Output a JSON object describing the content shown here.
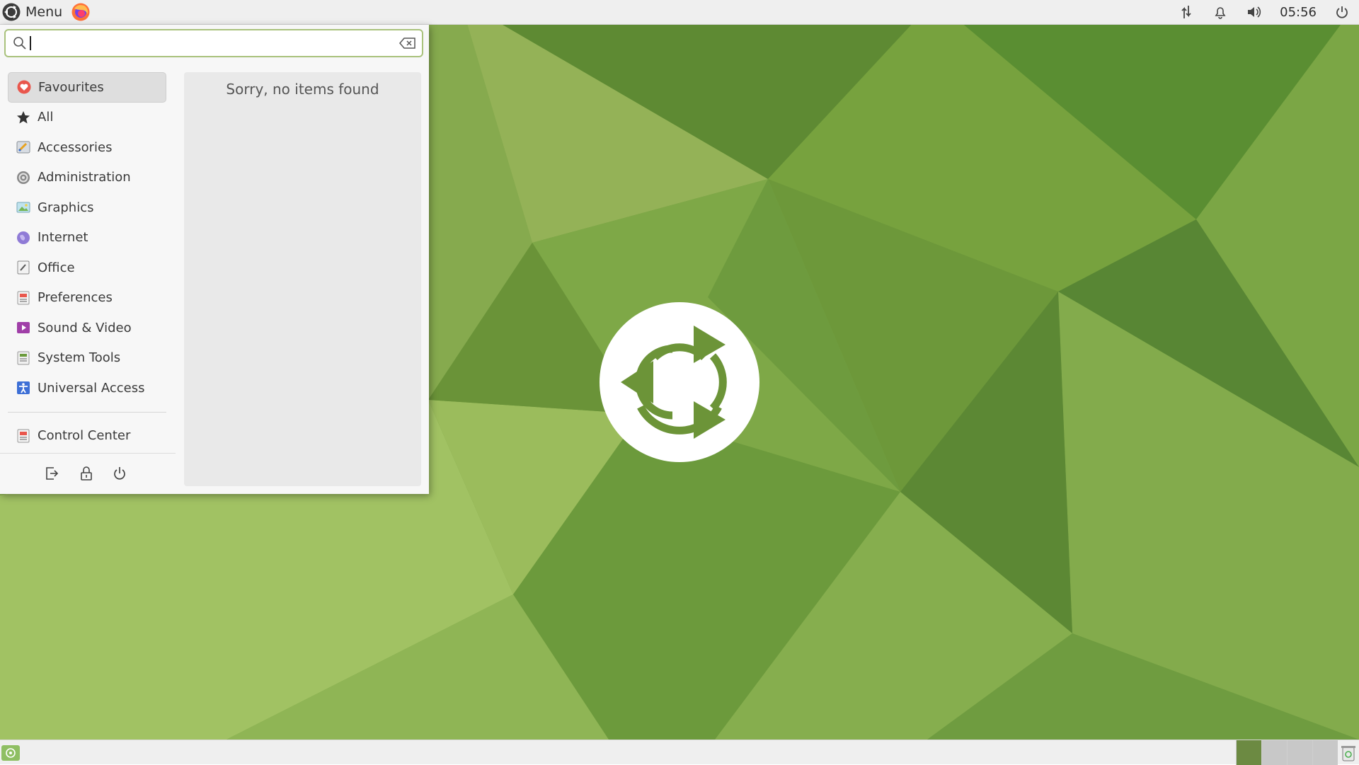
{
  "top_panel": {
    "menu_label": "Menu",
    "clock": "05:56",
    "icons": [
      "ubuntu-mate-logo-icon",
      "firefox-icon",
      "network-icon",
      "bell-icon",
      "volume-icon",
      "power-icon"
    ]
  },
  "menu": {
    "search": {
      "value": "",
      "placeholder": ""
    },
    "categories": [
      {
        "label": "Favourites",
        "icon": "heart-icon"
      },
      {
        "label": "All",
        "icon": "star-icon"
      },
      {
        "label": "Accessories",
        "icon": "accessories-icon"
      },
      {
        "label": "Administration",
        "icon": "administration-icon"
      },
      {
        "label": "Graphics",
        "icon": "graphics-icon"
      },
      {
        "label": "Internet",
        "icon": "internet-icon"
      },
      {
        "label": "Office",
        "icon": "office-icon"
      },
      {
        "label": "Preferences",
        "icon": "preferences-icon"
      },
      {
        "label": "Sound & Video",
        "icon": "sound-video-icon"
      },
      {
        "label": "System Tools",
        "icon": "system-tools-icon"
      },
      {
        "label": "Universal Access",
        "icon": "universal-access-icon"
      }
    ],
    "control_center": {
      "label": "Control Center",
      "icon": "control-center-icon"
    },
    "results_message": "Sorry, no items found",
    "actions": [
      "logout-icon",
      "lock-icon",
      "power-icon"
    ]
  },
  "colors": {
    "accent": "#a9c27c",
    "wallpaper_base": "#6e9a3e",
    "panel": "#efefef"
  }
}
